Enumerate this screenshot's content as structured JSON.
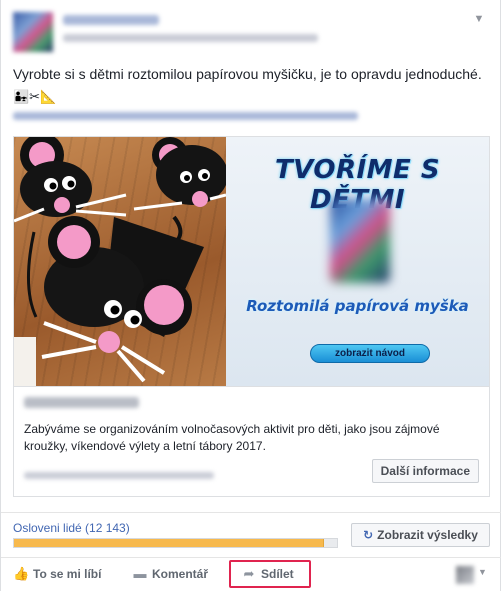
{
  "post": {
    "text": "Vyrobte si s dětmi roztomilou papírovou myšičku, je to opravdu jednoduché.",
    "emojis": "👨‍👧✂📐"
  },
  "card": {
    "promo_title": "TVOŘÍME S DĚTMI",
    "promo_subtitle": "Roztomilá papírová myška",
    "promo_button": "zobrazit návod",
    "description": "Zabýváme se organizováním volnočasových aktivit pro děti, jako jsou zájmové kroužky, víkendové výlety a letní tábory 2017.",
    "more_button": "Další informace"
  },
  "reach": {
    "label": "Osloveni lidé (12 143)",
    "fill_fraction": 0.96,
    "results_button": "Zobrazit výsledky"
  },
  "actions": {
    "like": "To se mi líbí",
    "comment": "Komentář",
    "share": "Sdílet"
  },
  "colors": {
    "link_blue": "#4267b2",
    "reach_orange": "#f7b94d",
    "share_highlight": "#e0244f"
  }
}
